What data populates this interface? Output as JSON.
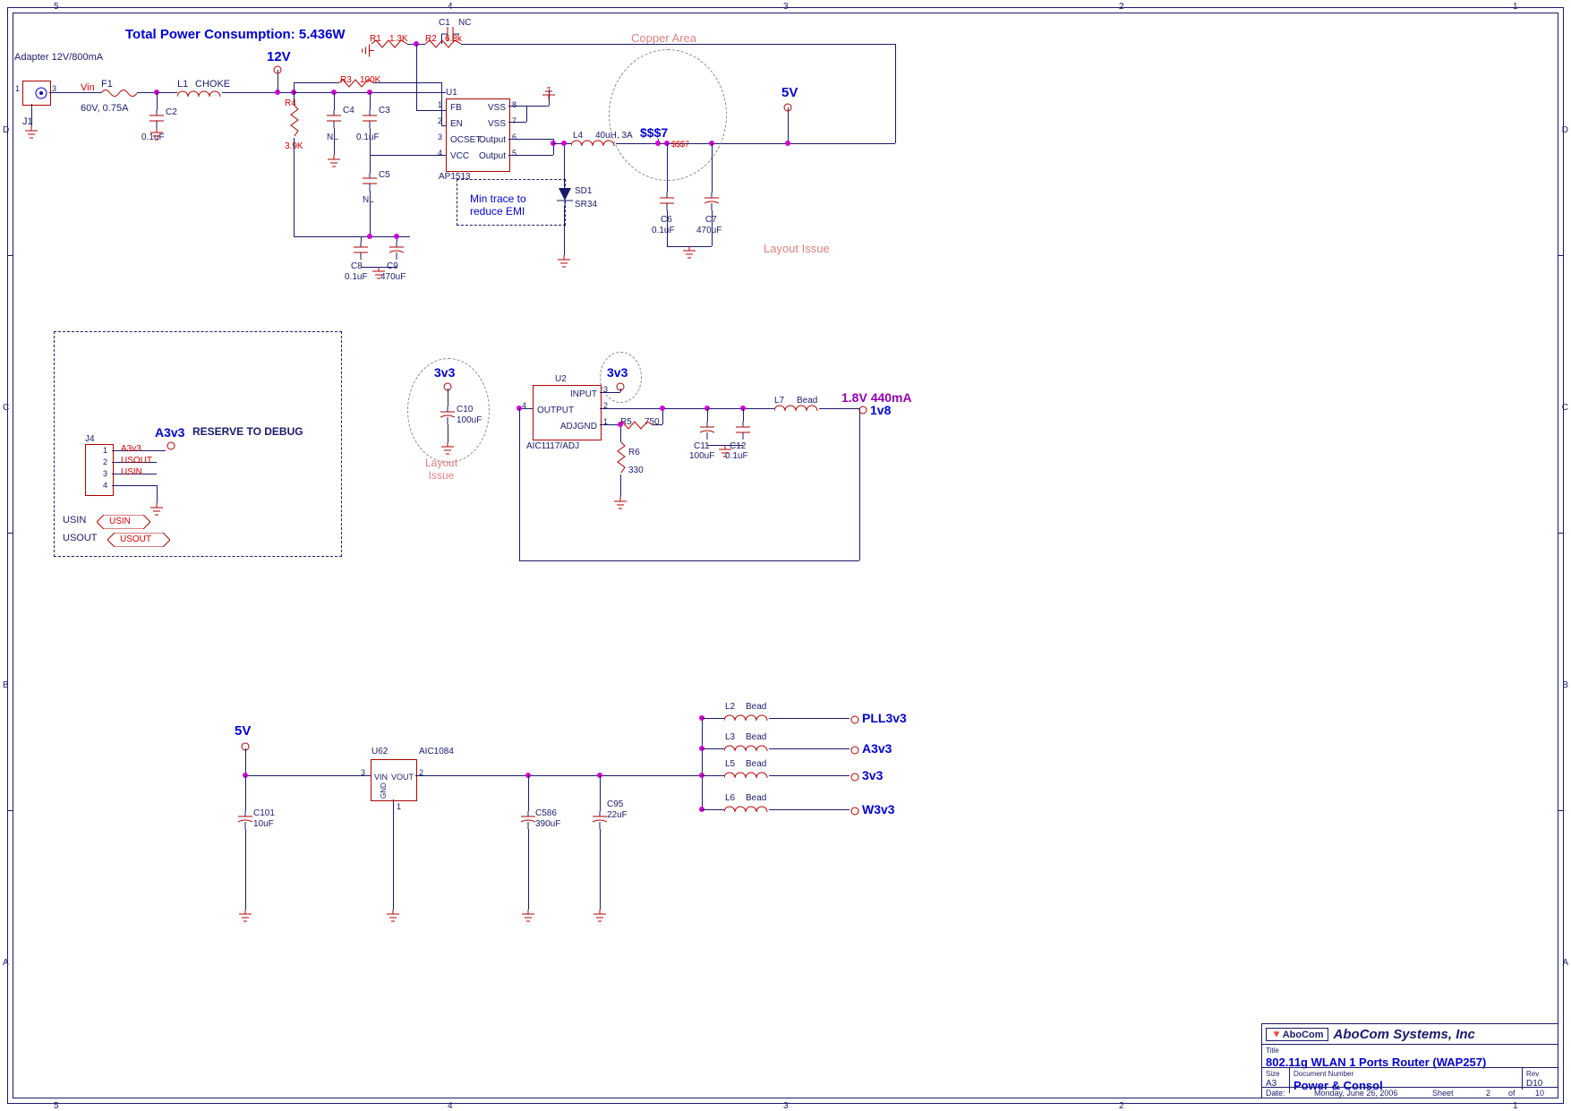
{
  "ruler": {
    "top_nums": [
      "5",
      "4",
      "3",
      "2",
      "1"
    ],
    "bot_nums": [
      "5",
      "4",
      "3",
      "2",
      "1"
    ],
    "left_lets": [
      "D",
      "C",
      "B",
      "A"
    ],
    "right_lets": [
      "D",
      "C",
      "B",
      "A"
    ]
  },
  "notes": {
    "power_total": "Total Power Consumption: 5.436W",
    "adapter": "Adapter 12V/800mA",
    "copper": "Copper Area",
    "layout1": "Layout Issue",
    "layout2": "Layout\nIssue",
    "emi": "Min trace to\nreduce EMI",
    "reserve": "RESERVE TO DEBUG",
    "rail18": "1.8V 440mA"
  },
  "rails": {
    "v12": "12V",
    "v5": "5V",
    "v3a": "3v3",
    "v3b": "3v3",
    "v1_8": "1v8",
    "pll": "PLL3v3",
    "a3v3": "A3v3",
    "r3v3": "3v3",
    "w3v3": "W3v3",
    "v5b": "5V",
    "a3v3_dbg": "A3v3",
    "vin": "Vin"
  },
  "parts": {
    "J1": {
      "ref": "J1"
    },
    "F1": {
      "ref": "F1",
      "val": "60V, 0.75A"
    },
    "L1": {
      "ref": "L1",
      "val": "CHOKE"
    },
    "C2": {
      "ref": "C2",
      "val": "0.1uF"
    },
    "R4": {
      "ref": "R4",
      "val": "3.9K"
    },
    "C4": {
      "ref": "C4",
      "val": "NL"
    },
    "C3": {
      "ref": "C3",
      "val": "0.1uF"
    },
    "C5": {
      "ref": "C5",
      "val": "NL"
    },
    "C8": {
      "ref": "C8",
      "val": "0.1uF"
    },
    "C9": {
      "ref": "C9",
      "val": "470uF"
    },
    "R1": {
      "ref": "R1",
      "val": "1.3K"
    },
    "R2": {
      "ref": "R2",
      "val": "6.8k"
    },
    "R3": {
      "ref": "R3",
      "val": "100K"
    },
    "C1": {
      "ref": "C1",
      "val": "NC"
    },
    "U1": {
      "ref": "U1",
      "val": "AP1513",
      "p1": "FB",
      "p2": "EN",
      "p3": "OCSET",
      "p4": "VCC",
      "p5": "Output",
      "p6": "Output",
      "p7": "VSS",
      "p8": "VSS"
    },
    "L4": {
      "ref": "L4",
      "val": "40uH, 3A"
    },
    "SD1": {
      "ref": "SD1",
      "val": "SR34"
    },
    "C6": {
      "ref": "C6",
      "val": "0.1uF"
    },
    "C7": {
      "ref": "C7",
      "val": "470uF"
    },
    "SSS7": {
      "ref": "$$$7",
      "val": "$$$7"
    },
    "C10": {
      "ref": "C10",
      "val": "100uF"
    },
    "U2": {
      "ref": "U2",
      "val": "AIC1117/ADJ",
      "pin": "INPUT",
      "pout": "OUTPUT",
      "padj": "ADJGND"
    },
    "R5": {
      "ref": "R5",
      "val": "750"
    },
    "R6": {
      "ref": "R6",
      "val": "330"
    },
    "L7": {
      "ref": "L7",
      "val": "Bead"
    },
    "C11": {
      "ref": "C11",
      "val": "100uF"
    },
    "C12": {
      "ref": "C12",
      "val": "0.1uF"
    },
    "J4": {
      "ref": "J4",
      "p1": "A3v3",
      "p2": "USOUT",
      "p3": "USIN",
      "p4": ""
    },
    "USIN": {
      "a": "USIN",
      "b": "USIN"
    },
    "USOUT": {
      "a": "USOUT",
      "b": "USOUT"
    },
    "C101": {
      "ref": "C101",
      "val": "10uF"
    },
    "U62": {
      "ref": "U62",
      "val": "AIC1084",
      "pvin": "VIN",
      "pvout": "VOUT",
      "pgnd": "GND"
    },
    "C586": {
      "ref": "C586",
      "val": "390uF"
    },
    "C95": {
      "ref": "C95",
      "val": "22uF"
    },
    "L2": {
      "ref": "L2",
      "val": "Bead"
    },
    "L3": {
      "ref": "L3",
      "val": "Bead"
    },
    "L5": {
      "ref": "L5",
      "val": "Bead"
    },
    "L6": {
      "ref": "L6",
      "val": "Bead"
    }
  },
  "pinnums": {
    "u1": [
      "1",
      "2",
      "3",
      "4",
      "5",
      "6",
      "7",
      "8"
    ],
    "u2": [
      "1",
      "2",
      "3",
      "4"
    ],
    "u62": [
      "1",
      "2",
      "3"
    ]
  },
  "titleblock": {
    "company": "AboCom Systems, Inc",
    "title_lbl": "Title",
    "title": "802.11g WLAN 1 Ports Router (WAP257)",
    "size_lbl": "Size",
    "size": "A3",
    "docnum_lbl": "Document Number",
    "docnum": "Power & Consol",
    "rev_lbl": "Rev",
    "rev": "D10",
    "date_lbl": "Date:",
    "date": "Monday, June 26, 2006",
    "sheet_lbl": "Sheet",
    "sheet_a": "2",
    "sheet_of": "of",
    "sheet_b": "10"
  }
}
